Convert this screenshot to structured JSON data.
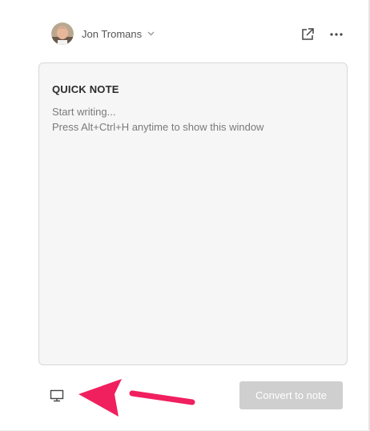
{
  "header": {
    "account_name": "Jon Tromans",
    "avatar_icon": "user-avatar",
    "dropdown_icon": "chevron-down-icon",
    "open_external_icon": "open-in-new-window-icon",
    "more_icon": "more-options-icon"
  },
  "note": {
    "title": "QUICK NOTE",
    "placeholder_line1": "Start writing...",
    "placeholder_line2": "Press Alt+Ctrl+H anytime to show this window"
  },
  "footer": {
    "device_icon": "monitor-icon",
    "convert_label": "Convert to note",
    "convert_enabled": false
  },
  "annotation": {
    "type": "arrow",
    "color": "#f0205f",
    "points_to": "monitor-icon"
  },
  "colors": {
    "card_background": "#f6f6f6",
    "card_border": "#d8d8d8",
    "button_disabled": "#cfcfcf",
    "annotation_arrow": "#f0205f"
  }
}
